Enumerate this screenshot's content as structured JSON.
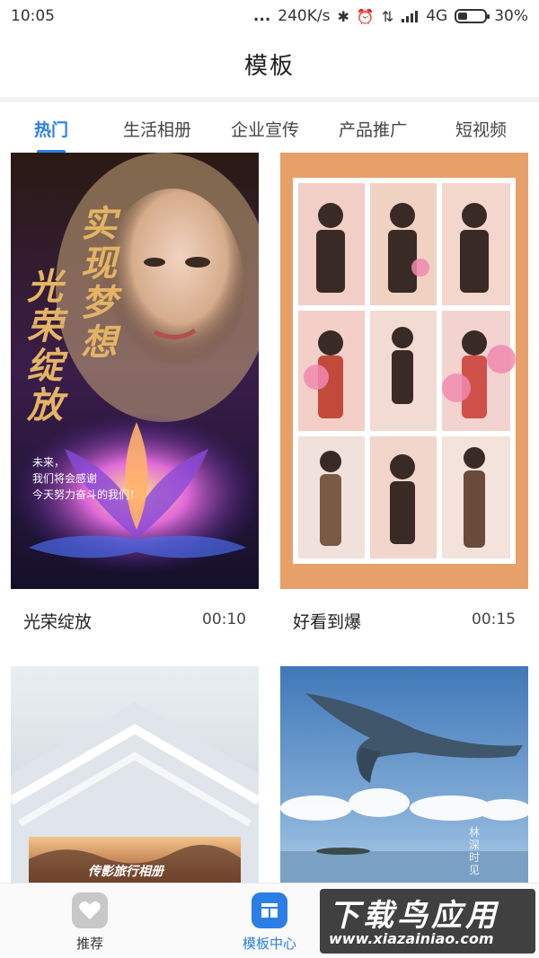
{
  "status_bar": {
    "time": "10:05",
    "dots": "...",
    "speed": "240K/s",
    "network": "4G",
    "battery": "30%"
  },
  "header": {
    "title": "模板"
  },
  "tabs": [
    {
      "label": "热门",
      "active": true
    },
    {
      "label": "生活相册",
      "active": false
    },
    {
      "label": "企业宣传",
      "active": false
    },
    {
      "label": "产品推广",
      "active": false
    },
    {
      "label": "短视频",
      "active": false
    }
  ],
  "cards": [
    {
      "title": "光荣绽放",
      "duration": "00:10",
      "overlay_calligraphy_1": "实现梦想",
      "overlay_calligraphy_2": "光荣绽放",
      "overlay_lines": [
        "未来，",
        "我们将会感谢",
        "今天努力奋斗的我们！"
      ]
    },
    {
      "title": "好看到爆",
      "duration": "00:15"
    },
    {
      "title": "",
      "duration": "",
      "overlay_text": "传影旅行相册"
    },
    {
      "title": "",
      "duration": "",
      "overlay_text": "林深时见"
    }
  ],
  "bottom_nav": [
    {
      "label": "推荐",
      "icon": "heart-icon",
      "active": false
    },
    {
      "label": "模板中心",
      "icon": "template-icon",
      "active": true
    }
  ],
  "watermark": {
    "logo": "下载鸟应用",
    "url": "www.xiazainiao.com"
  },
  "colors": {
    "accent": "#2a7ee6",
    "card2_frame": "#e8a06a"
  }
}
